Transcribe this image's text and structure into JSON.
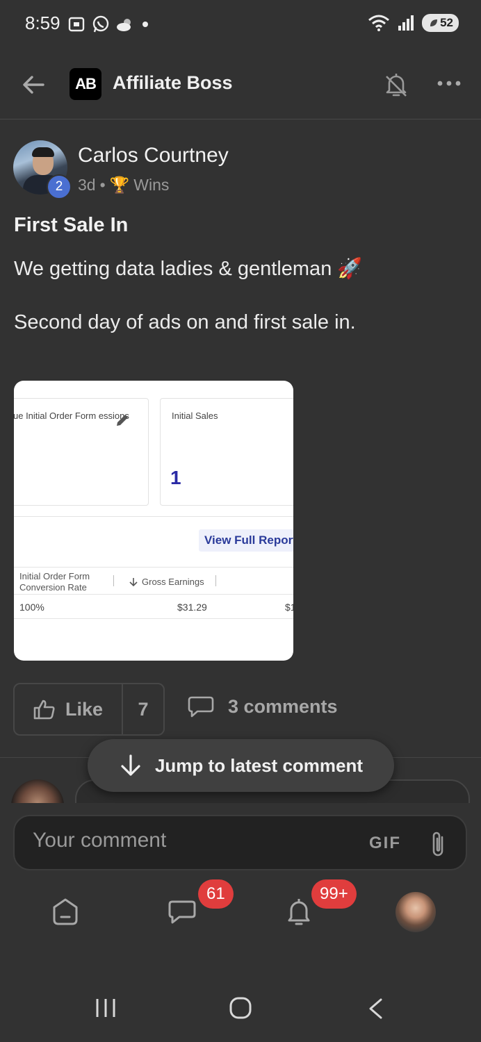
{
  "status_bar": {
    "time": "8:59",
    "battery": "52"
  },
  "header": {
    "logo_text": "AB",
    "title": "Affiliate Boss"
  },
  "post": {
    "author": "Carlos Courtney",
    "level": "2",
    "age": "3d",
    "separator": "•",
    "category_icon": "🏆",
    "category": "Wins",
    "title": "First Sale In",
    "body_line1": "We getting data ladies & gentleman 🚀",
    "body_line2": "Second day of ads on and first sale in."
  },
  "attachment": {
    "card1_label": "ue Initial Order Form essions",
    "card2_label": "Initial Sales",
    "card2_value": "1",
    "view_report_label": "View Full Report",
    "col1_header": "Initial Order Form Conversion Rate",
    "col2_header": "Gross Earnings",
    "row_col1": "100%",
    "row_col2": "$31.29",
    "row_col3": "$1"
  },
  "actions": {
    "like_label": "Like",
    "like_count": "7",
    "comments_label": "3 comments",
    "jump_label": "Jump to latest comment"
  },
  "composer": {
    "placeholder": "Your comment",
    "gif_label": "GIF"
  },
  "bottom_nav": {
    "chat_badge": "61",
    "notifications_badge": "99+"
  },
  "colors": {
    "background": "#323232",
    "badge_red": "#e03d3d",
    "level_blue": "#4a6fd1",
    "metric_value": "#2a2aa5"
  }
}
